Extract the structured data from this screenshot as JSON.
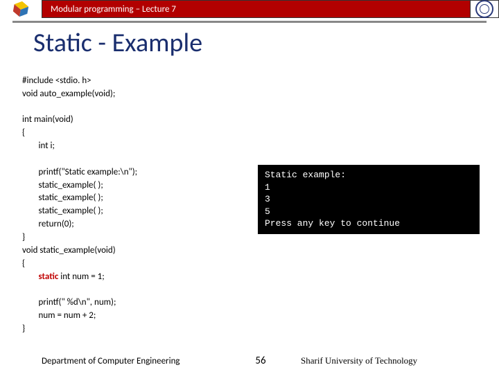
{
  "header": {
    "course": "Modular programming – Lecture 7"
  },
  "title": "Static - Example",
  "code": {
    "l1": "#include <stdio. h>",
    "l2": "void auto_example(void);",
    "l3": "",
    "l4": "int main(void)",
    "l5": "{",
    "l6": "        int i;",
    "l7": "",
    "l8": "        printf(\"Static example:\\n\");",
    "l9": "        static_example( );",
    "l10": "        static_example( );",
    "l11": "        static_example( );",
    "l12": "        return(0);",
    "l13": "}",
    "l14": "void static_example(void)",
    "l15": "{",
    "static_kw": "static",
    "l16_rest": " int num = 1;",
    "l17": "",
    "l18": "        printf(\" %d\\n\", num);",
    "l19": "        num = num + 2;",
    "l20": "}"
  },
  "output": {
    "l1": "Static example:",
    "l2": "1",
    "l3": "3",
    "l4": "5",
    "l5": "Press any key to continue"
  },
  "footer": {
    "dept": "Department of Computer Engineering",
    "page": "56",
    "uni": "Sharif University of Technology"
  }
}
